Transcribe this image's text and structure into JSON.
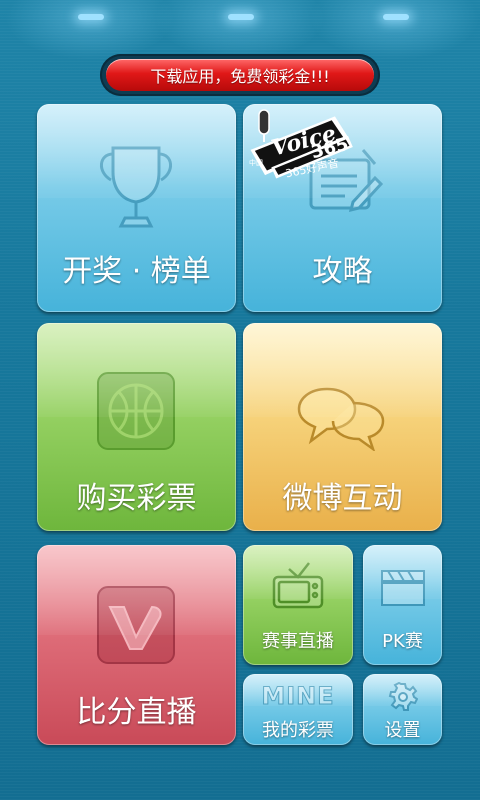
{
  "banner": {
    "text": "下载应用，免费领彩金!!!"
  },
  "tiles": {
    "lottery_results": {
      "label": "开奖 · 榜单",
      "icon": "trophy-icon"
    },
    "strategy": {
      "label": "攻略",
      "icon": "notepad-pen-icon"
    },
    "voice_logo": {
      "word": "Voice",
      "num": "365",
      "sub": "365好声音",
      "small": "中国"
    },
    "buy_lottery": {
      "label": "购买彩票",
      "icon": "basketball-icon"
    },
    "weibo": {
      "label": "微博互动",
      "icon": "chat-bubbles-icon"
    },
    "live_score": {
      "label": "比分直播",
      "icon": "v-logo-icon"
    },
    "match_live": {
      "label": "赛事直播",
      "icon": "tv-icon"
    },
    "pk": {
      "label": "PK赛",
      "icon": "clapperboard-icon"
    },
    "my_lottery": {
      "label": "我的彩票",
      "badge": "MINE"
    },
    "settings": {
      "label": "设置",
      "icon": "gear-icon"
    }
  }
}
